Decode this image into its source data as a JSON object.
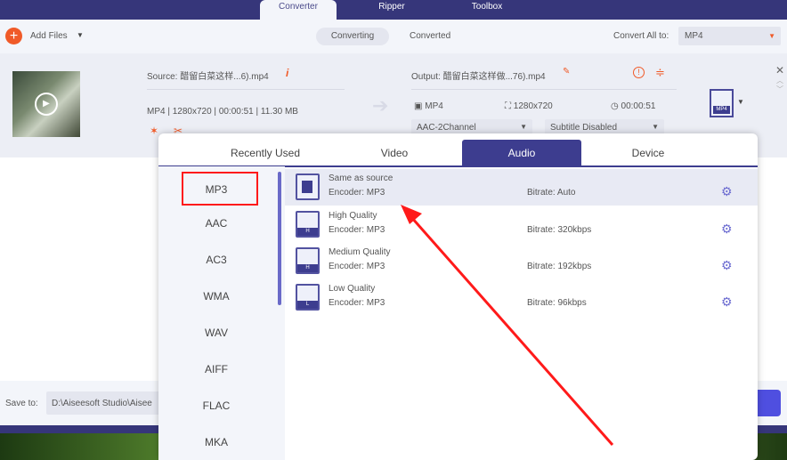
{
  "nav": {
    "tabs": [
      "Converter",
      "Ripper",
      "Toolbox"
    ]
  },
  "toolbar": {
    "add_files": "Add Files",
    "converting": "Converting",
    "converted": "Converted",
    "convert_all_label": "Convert All to:",
    "convert_all_value": "MP4"
  },
  "file": {
    "source": "Source: 醋留白菜这样...6).mp4",
    "format": "MP4",
    "resolution": "1280x720",
    "duration": "00:00:51",
    "size": "11.30 MB",
    "output": "Output: 醋留白菜这样做...76).mp4",
    "out_format": "MP4",
    "out_resolution": "1280x720",
    "out_duration": "00:00:51",
    "audio": "AAC-2Channel",
    "subtitle": "Subtitle Disabled",
    "badge": "MP4"
  },
  "save": {
    "label": "Save to:",
    "path": "D:\\Aiseesoft Studio\\Aisee"
  },
  "popup": {
    "tabs": [
      "Recently Used",
      "Video",
      "Audio",
      "Device"
    ],
    "active_tab": "Audio",
    "formats": [
      "MP3",
      "AAC",
      "AC3",
      "WMA",
      "WAV",
      "AIFF",
      "FLAC",
      "MKA"
    ],
    "selected_format": "MP3",
    "presets": [
      {
        "name": "Same as source",
        "encoder": "Encoder: MP3",
        "bitrate": "Bitrate: Auto",
        "badge": ""
      },
      {
        "name": "High Quality",
        "encoder": "Encoder: MP3",
        "bitrate": "Bitrate: 320kbps",
        "badge": "H"
      },
      {
        "name": "Medium Quality",
        "encoder": "Encoder: MP3",
        "bitrate": "Bitrate: 192kbps",
        "badge": "H"
      },
      {
        "name": "Low Quality",
        "encoder": "Encoder: MP3",
        "bitrate": "Bitrate: 96kbps",
        "badge": "L"
      }
    ]
  },
  "colors": {
    "navy": "#36367a",
    "accent": "#3d3d8f",
    "orange": "#f05a28",
    "annotation": "#ff1a1a"
  }
}
